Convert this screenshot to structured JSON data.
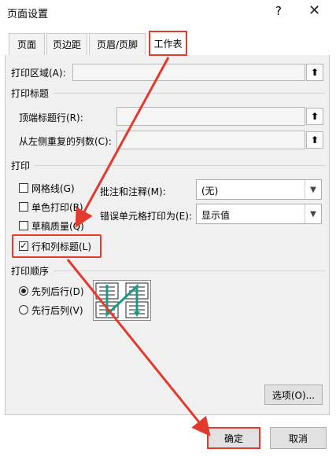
{
  "dialog": {
    "title": "页面设置",
    "help_glyph": "?",
    "close_glyph": "✕"
  },
  "tabs": [
    {
      "label": "页面"
    },
    {
      "label": "页边距"
    },
    {
      "label": "页眉/页脚"
    },
    {
      "label": "工作表",
      "active": true
    }
  ],
  "print_area": {
    "label": "打印区域(A):",
    "value": ""
  },
  "print_titles": {
    "section": "打印标题",
    "top_rows_label": "顶端标题行(R):",
    "top_rows_value": "",
    "left_cols_label": "从左侧重复的列数(C):",
    "left_cols_value": ""
  },
  "print": {
    "section": "打印",
    "gridlines": {
      "label": "网格线(G)",
      "checked": false
    },
    "black_white": {
      "label": "单色打印(B)",
      "checked": false
    },
    "draft": {
      "label": "草稿质量(Q)",
      "checked": false
    },
    "row_col_headings": {
      "label": "行和列标题(L)",
      "checked": true
    },
    "comments_label": "批注和注释(M):",
    "comments_value": "(无)",
    "errors_label": "错误单元格打印为(E):",
    "errors_value": "显示值"
  },
  "page_order": {
    "section": "打印顺序",
    "down_then_over": {
      "label": "先列后行(D)",
      "selected": true
    },
    "over_then_down": {
      "label": "先行后列(V)",
      "selected": false
    }
  },
  "buttons": {
    "options": "选项(O)...",
    "ok": "确定",
    "cancel": "取消"
  },
  "colors": {
    "highlight": "#e23b2e",
    "arrow": "#e23b2e",
    "order_path": "#1a9a86"
  },
  "icons": {
    "collapse": "collapse-dialog-icon",
    "dropdown": "chevron-down-icon"
  }
}
